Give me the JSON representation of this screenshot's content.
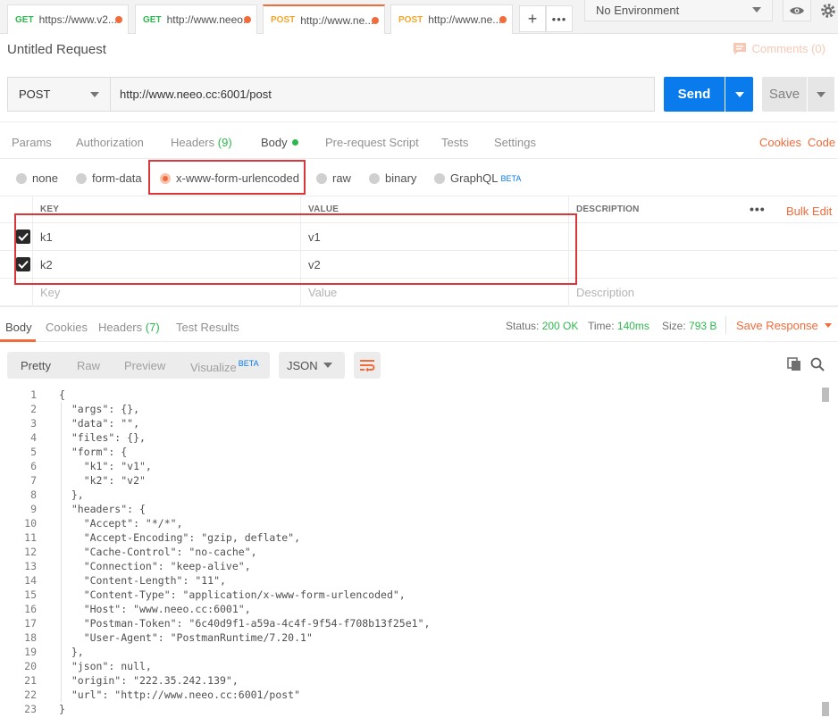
{
  "tabs": [
    {
      "method": "GET",
      "url": "https://www.v2..."
    },
    {
      "method": "GET",
      "url": "http://www.neeo..."
    },
    {
      "method": "POST",
      "url": "http://www.ne..."
    },
    {
      "method": "POST",
      "url": "http://www.ne..."
    }
  ],
  "environment": {
    "selected": "No Environment"
  },
  "request": {
    "title": "Untitled Request",
    "comments_label": "Comments (0)",
    "method": "POST",
    "url": "http://www.neeo.cc:6001/post",
    "send_label": "Send",
    "save_label": "Save"
  },
  "request_tabs": {
    "params": "Params",
    "authorization": "Authorization",
    "headers": "Headers",
    "headers_count": "(9)",
    "body": "Body",
    "prerequest": "Pre-request Script",
    "tests": "Tests",
    "settings": "Settings",
    "cookies": "Cookies",
    "code": "Code"
  },
  "body_types": {
    "none": "none",
    "form_data": "form-data",
    "urlencoded": "x-www-form-urlencoded",
    "raw": "raw",
    "binary": "binary",
    "graphql": "GraphQL",
    "graphql_badge": "BETA",
    "selected": "x-www-form-urlencoded"
  },
  "params_table": {
    "headers": {
      "key": "KEY",
      "value": "VALUE",
      "description": "DESCRIPTION",
      "more": "•••",
      "bulk_edit": "Bulk Edit"
    },
    "rows": [
      {
        "key": "k1",
        "value": "v1",
        "description": "",
        "checked": true
      },
      {
        "key": "k2",
        "value": "v2",
        "description": "",
        "checked": true
      }
    ],
    "placeholders": {
      "key": "Key",
      "value": "Value",
      "description": "Description"
    }
  },
  "response_tabs": {
    "body": "Body",
    "cookies": "Cookies",
    "headers": "Headers",
    "headers_count": "(7)",
    "test_results": "Test Results"
  },
  "response_status": {
    "status_label": "Status:",
    "status_value": "200 OK",
    "time_label": "Time:",
    "time_value": "140ms",
    "size_label": "Size:",
    "size_value": "793 B",
    "save_response": "Save Response"
  },
  "response_view": {
    "pretty": "Pretty",
    "raw": "Raw",
    "preview": "Preview",
    "visualize": "Visualize",
    "visualize_badge": "BETA",
    "format": "JSON"
  },
  "response_body": [
    "{",
    "  \"args\": {},",
    "  \"data\": \"\",",
    "  \"files\": {},",
    "  \"form\": {",
    "    \"k1\": \"v1\",",
    "    \"k2\": \"v2\"",
    "  },",
    "  \"headers\": {",
    "    \"Accept\": \"*/*\",",
    "    \"Accept-Encoding\": \"gzip, deflate\",",
    "    \"Cache-Control\": \"no-cache\",",
    "    \"Connection\": \"keep-alive\",",
    "    \"Content-Length\": \"11\",",
    "    \"Content-Type\": \"application/x-www-form-urlencoded\",",
    "    \"Host\": \"www.neeo.cc:6001\",",
    "    \"Postman-Token\": \"6c40d9f1-a59a-4c4f-9f54-f708b13f25e1\",",
    "    \"User-Agent\": \"PostmanRuntime/7.20.1\"",
    "  },",
    "  \"json\": null,",
    "  \"origin\": \"222.35.242.139\",",
    "  \"url\": \"http://www.neeo.cc:6001/post\"",
    "}"
  ],
  "colors": {
    "accent": "#f26b3a",
    "send_blue": "#097bed",
    "status_green": "#2db84d",
    "annotation_red": "#d9373a"
  }
}
